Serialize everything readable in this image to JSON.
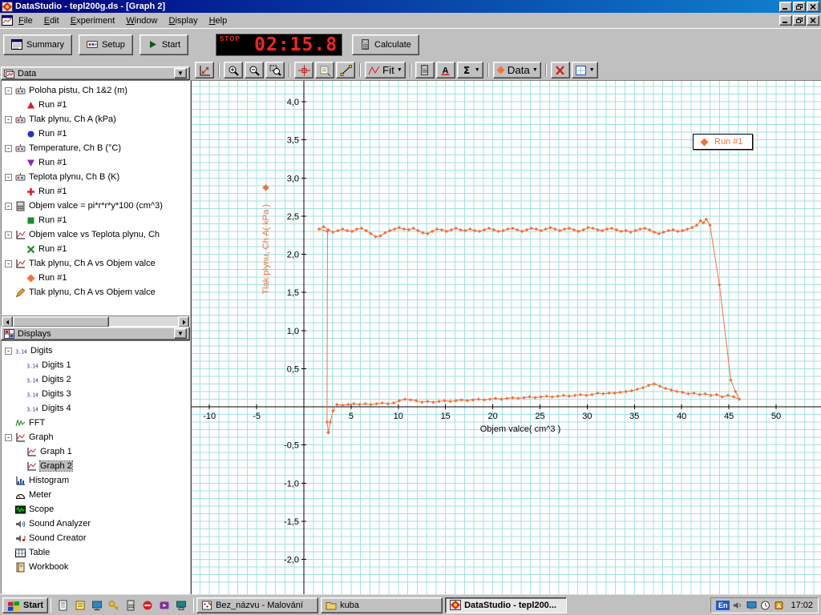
{
  "window": {
    "title": "DataStudio - tepl200g.ds - [Graph 2]",
    "menus": [
      "File",
      "Edit",
      "Experiment",
      "Window",
      "Display",
      "Help"
    ]
  },
  "toolbar": {
    "summary_label": "Summary",
    "setup_label": "Setup",
    "start_label": "Start",
    "stop_label": "STOP",
    "timer_value": "02:15.8",
    "calculate_label": "Calculate"
  },
  "graph_toolbar": {
    "buttons": [
      {
        "name": "scale-to-fit-button",
        "icon": "scale-fit-icon"
      },
      {
        "sep": true
      },
      {
        "name": "zoom-in-button",
        "icon": "zoom-in-icon"
      },
      {
        "name": "zoom-out-button",
        "icon": "zoom-out-icon"
      },
      {
        "name": "zoom-select-button",
        "icon": "zoom-select-icon"
      },
      {
        "sep": true
      },
      {
        "name": "smart-tool-button",
        "icon": "smart-tool-icon"
      },
      {
        "name": "annotation-tool-button",
        "icon": "note-tool-icon"
      },
      {
        "name": "slope-tool-button",
        "icon": "slope-tool-icon"
      },
      {
        "sep": true
      },
      {
        "name": "fit-dropdown",
        "icon": "fit-icon",
        "label": "Fit",
        "dropdown": true
      },
      {
        "sep": true
      },
      {
        "name": "calculator-button",
        "icon": "calc-tool-icon"
      },
      {
        "name": "text-annotation-button",
        "icon": "text-a-icon"
      },
      {
        "name": "statistics-dropdown",
        "icon": "sigma-icon",
        "dropdown": true
      },
      {
        "sep": true
      },
      {
        "name": "data-dropdown",
        "icon": "diamond-orange",
        "label": "Data",
        "dropdown": true
      },
      {
        "sep": true
      },
      {
        "name": "remove-button",
        "icon": "delete-x-icon"
      },
      {
        "name": "graph-settings-dropdown",
        "icon": "axis-settings-icon",
        "dropdown": true
      }
    ]
  },
  "data_panel": {
    "title": "Data",
    "items": [
      {
        "label": "Poloha pistu, Ch 1&2 (m)",
        "icon": "sensor-icon",
        "runs": [
          {
            "label": "Run #1",
            "marker": "triangle-up-red"
          }
        ]
      },
      {
        "label": "Tlak plynu, Ch A (kPa)",
        "icon": "sensor-icon",
        "runs": [
          {
            "label": "Run #1",
            "marker": "circle-blue"
          }
        ]
      },
      {
        "label": "Temperature, Ch B (°C)",
        "icon": "sensor-icon",
        "runs": [
          {
            "label": "Run #1",
            "marker": "triangle-down-purple"
          }
        ]
      },
      {
        "label": "Teplota plynu, Ch B (K)",
        "icon": "sensor-icon",
        "runs": [
          {
            "label": "Run #1",
            "marker": "plus-red"
          }
        ]
      },
      {
        "label": "Objem valce = pi*r*r*y*100 (cm^3)",
        "icon": "calc-data-icon",
        "runs": [
          {
            "label": "Run #1",
            "marker": "square-green"
          }
        ]
      },
      {
        "label": "Objem valce vs Teplota plynu, Ch",
        "icon": "graph-data-icon",
        "runs": [
          {
            "label": "Run #1",
            "marker": "x-green"
          }
        ]
      },
      {
        "label": "Tlak plynu, Ch A vs Objem valce",
        "icon": "graph-data-icon",
        "runs": [
          {
            "label": "Run #1",
            "marker": "diamond-orange"
          }
        ]
      },
      {
        "label": "Tlak plynu, Ch A vs Objem valce",
        "icon": "pen-icon",
        "runs": []
      }
    ]
  },
  "displays_panel": {
    "title": "Displays",
    "items": [
      {
        "label": "Digits",
        "icon": "digits-icon",
        "children": [
          "Digits 1",
          "Digits 2",
          "Digits 3",
          "Digits 4"
        ]
      },
      {
        "label": "FFT",
        "icon": "fft-icon"
      },
      {
        "label": "Graph",
        "icon": "graph-icon",
        "children": [
          "Graph 1",
          "Graph 2"
        ],
        "selected": "Graph 2"
      },
      {
        "label": "Histogram",
        "icon": "histogram-icon"
      },
      {
        "label": "Meter",
        "icon": "meter-icon"
      },
      {
        "label": "Scope",
        "icon": "scope-icon"
      },
      {
        "label": "Sound Analyzer",
        "icon": "sound-analyzer-icon"
      },
      {
        "label": "Sound Creator",
        "icon": "sound-creator-icon"
      },
      {
        "label": "Table",
        "icon": "table-icon"
      },
      {
        "label": "Workbook",
        "icon": "workbook-icon"
      }
    ]
  },
  "chart_data": {
    "type": "line",
    "title": "",
    "xlabel": "Objem valce( cm^3 )",
    "ylabel": "Tlak plynu, Ch A( kPa )",
    "x_ticks": [
      -10,
      -5,
      5,
      10,
      15,
      20,
      25,
      30,
      35,
      40,
      45,
      50
    ],
    "y_ticks": [
      4.0,
      3.5,
      3.0,
      2.5,
      2.0,
      1.5,
      1.0,
      0.5,
      -0.5,
      -1.0,
      -1.5,
      -2.0
    ],
    "xlim": [
      -11.9,
      54.8
    ],
    "ylim": [
      -2.47,
      4.28
    ],
    "grid": {
      "color": "#a2e2e2",
      "minor_x": 1,
      "minor_y": 0.1
    },
    "axis_color": "#000000",
    "legend": {
      "position": "top-right"
    },
    "series": [
      {
        "name": "Run #1",
        "color": "#f4713c",
        "marker": "diamond",
        "points": [
          [
            2.6,
            -0.34
          ],
          [
            2.45,
            -0.2
          ],
          [
            2.5,
            2.3
          ],
          [
            1.6,
            2.33
          ],
          [
            2.1,
            2.36
          ],
          [
            2.6,
            2.32
          ],
          [
            3.1,
            2.29
          ],
          [
            3.6,
            2.31
          ],
          [
            4.1,
            2.33
          ],
          [
            4.6,
            2.31
          ],
          [
            5.1,
            2.3
          ],
          [
            5.6,
            2.33
          ],
          [
            6.1,
            2.34
          ],
          [
            6.6,
            2.31
          ],
          [
            7.1,
            2.27
          ],
          [
            7.6,
            2.23
          ],
          [
            8.1,
            2.24
          ],
          [
            8.6,
            2.28
          ],
          [
            9.1,
            2.31
          ],
          [
            9.6,
            2.33
          ],
          [
            10.1,
            2.35
          ],
          [
            10.6,
            2.33
          ],
          [
            11.1,
            2.32
          ],
          [
            11.6,
            2.34
          ],
          [
            12.1,
            2.31
          ],
          [
            12.6,
            2.28
          ],
          [
            13.1,
            2.27
          ],
          [
            13.6,
            2.3
          ],
          [
            14.1,
            2.33
          ],
          [
            14.6,
            2.32
          ],
          [
            15.1,
            2.3
          ],
          [
            15.6,
            2.32
          ],
          [
            16.1,
            2.34
          ],
          [
            16.6,
            2.32
          ],
          [
            17.1,
            2.31
          ],
          [
            17.6,
            2.33
          ],
          [
            18.1,
            2.31
          ],
          [
            18.6,
            2.3
          ],
          [
            19.1,
            2.32
          ],
          [
            19.6,
            2.34
          ],
          [
            20.1,
            2.32
          ],
          [
            20.6,
            2.3
          ],
          [
            21.1,
            2.31
          ],
          [
            21.6,
            2.33
          ],
          [
            22.1,
            2.34
          ],
          [
            22.6,
            2.32
          ],
          [
            23.1,
            2.3
          ],
          [
            23.6,
            2.32
          ],
          [
            24.1,
            2.34
          ],
          [
            24.6,
            2.33
          ],
          [
            25.1,
            2.31
          ],
          [
            25.6,
            2.33
          ],
          [
            26.1,
            2.35
          ],
          [
            26.6,
            2.33
          ],
          [
            27.1,
            2.31
          ],
          [
            27.6,
            2.33
          ],
          [
            28.1,
            2.34
          ],
          [
            28.6,
            2.32
          ],
          [
            29.1,
            2.3
          ],
          [
            29.6,
            2.32
          ],
          [
            30.1,
            2.35
          ],
          [
            30.6,
            2.34
          ],
          [
            31.1,
            2.32
          ],
          [
            31.6,
            2.31
          ],
          [
            32.1,
            2.33
          ],
          [
            32.6,
            2.34
          ],
          [
            33.1,
            2.32
          ],
          [
            33.6,
            2.3
          ],
          [
            34.1,
            2.31
          ],
          [
            34.6,
            2.29
          ],
          [
            35.1,
            2.31
          ],
          [
            35.6,
            2.33
          ],
          [
            36.1,
            2.34
          ],
          [
            36.6,
            2.32
          ],
          [
            37.1,
            2.29
          ],
          [
            37.6,
            2.27
          ],
          [
            38.1,
            2.29
          ],
          [
            38.6,
            2.31
          ],
          [
            39.1,
            2.32
          ],
          [
            39.6,
            2.3
          ],
          [
            40.1,
            2.31
          ],
          [
            40.6,
            2.33
          ],
          [
            41.1,
            2.35
          ],
          [
            41.6,
            2.38
          ],
          [
            42.0,
            2.44
          ],
          [
            42.3,
            2.41
          ],
          [
            42.6,
            2.46
          ],
          [
            43.0,
            2.38
          ],
          [
            44.0,
            1.6
          ],
          [
            45.2,
            0.35
          ],
          [
            45.7,
            0.2
          ],
          [
            46.1,
            0.1
          ],
          [
            45.5,
            0.13
          ],
          [
            44.9,
            0.15
          ],
          [
            44.3,
            0.13
          ],
          [
            43.7,
            0.16
          ],
          [
            43.1,
            0.15
          ],
          [
            42.5,
            0.17
          ],
          [
            41.9,
            0.16
          ],
          [
            41.3,
            0.18
          ],
          [
            40.7,
            0.17
          ],
          [
            40.1,
            0.19
          ],
          [
            39.5,
            0.2
          ],
          [
            38.9,
            0.22
          ],
          [
            38.3,
            0.24
          ],
          [
            37.7,
            0.27
          ],
          [
            37.1,
            0.3
          ],
          [
            36.5,
            0.28
          ],
          [
            35.9,
            0.25
          ],
          [
            35.3,
            0.23
          ],
          [
            34.7,
            0.21
          ],
          [
            34.1,
            0.2
          ],
          [
            33.5,
            0.19
          ],
          [
            32.9,
            0.18
          ],
          [
            32.3,
            0.18
          ],
          [
            31.7,
            0.17
          ],
          [
            31.1,
            0.18
          ],
          [
            30.5,
            0.16
          ],
          [
            29.9,
            0.15
          ],
          [
            29.3,
            0.16
          ],
          [
            28.7,
            0.15
          ],
          [
            28.1,
            0.14
          ],
          [
            27.5,
            0.15
          ],
          [
            26.9,
            0.14
          ],
          [
            26.3,
            0.13
          ],
          [
            25.7,
            0.14
          ],
          [
            25.1,
            0.13
          ],
          [
            24.5,
            0.12
          ],
          [
            23.9,
            0.13
          ],
          [
            23.3,
            0.12
          ],
          [
            22.7,
            0.11
          ],
          [
            22.1,
            0.12
          ],
          [
            21.5,
            0.11
          ],
          [
            20.9,
            0.1
          ],
          [
            20.3,
            0.11
          ],
          [
            19.7,
            0.1
          ],
          [
            19.1,
            0.09
          ],
          [
            18.5,
            0.1
          ],
          [
            17.9,
            0.09
          ],
          [
            17.3,
            0.08
          ],
          [
            16.7,
            0.09
          ],
          [
            16.1,
            0.08
          ],
          [
            15.5,
            0.07
          ],
          [
            14.9,
            0.08
          ],
          [
            14.3,
            0.07
          ],
          [
            13.7,
            0.06
          ],
          [
            13.1,
            0.07
          ],
          [
            12.5,
            0.06
          ],
          [
            11.9,
            0.08
          ],
          [
            11.3,
            0.09
          ],
          [
            10.7,
            0.1
          ],
          [
            10.1,
            0.08
          ],
          [
            9.5,
            0.05
          ],
          [
            8.9,
            0.04
          ],
          [
            8.3,
            0.05
          ],
          [
            7.7,
            0.04
          ],
          [
            7.1,
            0.03
          ],
          [
            6.5,
            0.04
          ],
          [
            5.9,
            0.03
          ],
          [
            5.3,
            0.04
          ],
          [
            4.7,
            0.03
          ],
          [
            4.1,
            0.02
          ],
          [
            3.5,
            0.03
          ],
          [
            3.1,
            -0.05
          ],
          [
            2.8,
            -0.2
          ],
          [
            2.6,
            -0.33
          ]
        ]
      }
    ]
  },
  "taskbar": {
    "start_label": "Start",
    "quick_launch": [
      "document-icon",
      "notes-icon",
      "desktop-icon",
      "key-icon",
      "calculator-small-icon",
      "stop-sign-icon",
      "media-icon",
      "network-icon"
    ],
    "tasks": [
      {
        "label": "Bez_názvu - Malování",
        "icon": "paint-icon",
        "active": false
      },
      {
        "label": "kuba",
        "icon": "folder-icon",
        "active": false
      },
      {
        "label": "DataStudio - tepl200...",
        "icon": "app-icon",
        "active": true
      }
    ],
    "tray": {
      "language": "En",
      "icons": [
        "volume-icon",
        "display-icon",
        "scheduler-icon",
        "antivirus-icon"
      ],
      "time": "17:02"
    }
  }
}
